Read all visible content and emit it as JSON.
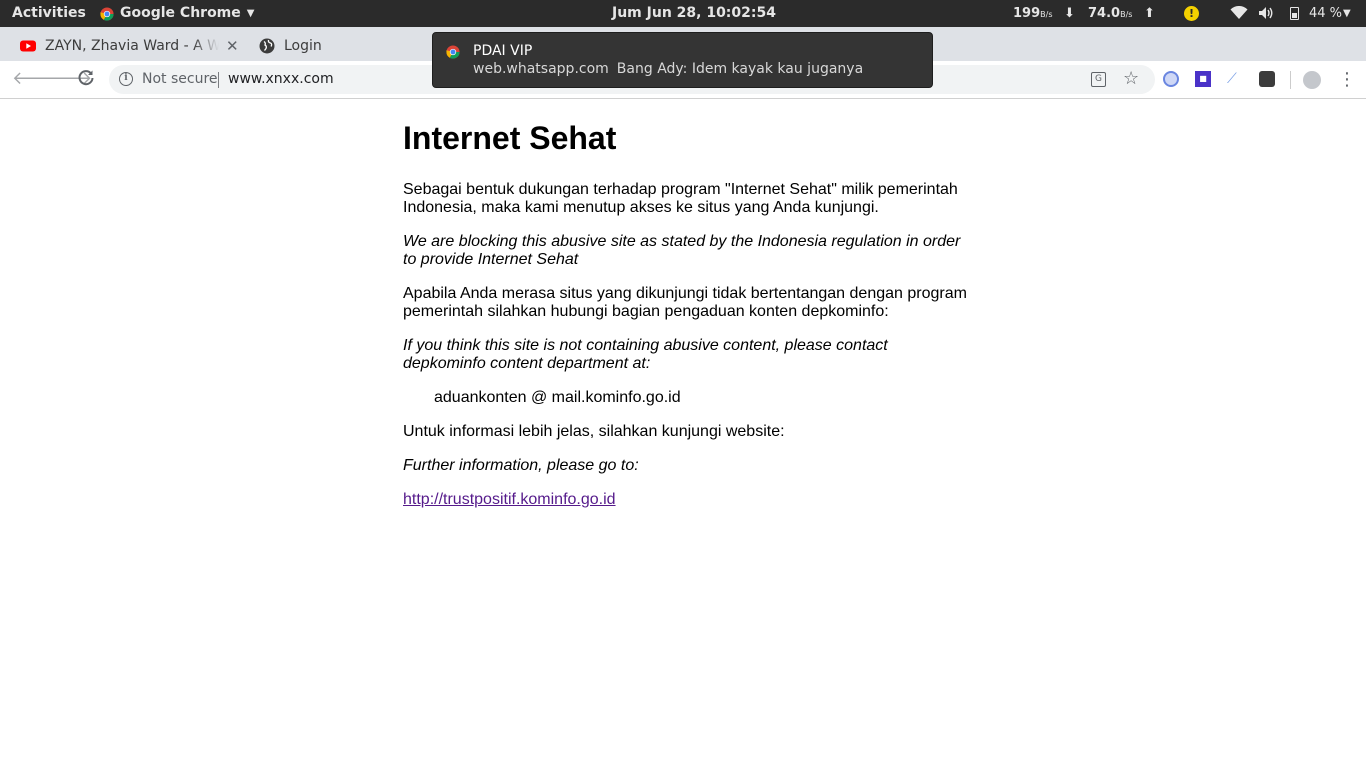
{
  "topbar": {
    "activities": "Activities",
    "app_name": "Google Chrome",
    "clock": "Jum Jun 28, 10:02:54",
    "net_down_value": "199",
    "net_down_unit": "B/s",
    "net_up_value": "74.0",
    "net_up_unit": "B/s",
    "battery_percent": "44 %"
  },
  "tabs": [
    {
      "title": "ZAYN, Zhavia Ward - A Whole New World",
      "favicon": "youtube-icon"
    },
    {
      "title": "Login",
      "favicon": "globe-icon"
    }
  ],
  "toolbar": {
    "security_label": "Not secure",
    "url": "www.xnxx.com"
  },
  "notification": {
    "title": "PDAI VIP",
    "source": "web.whatsapp.com",
    "message": "Bang Ady: Idem kayak kau juganya"
  },
  "page": {
    "heading": "Internet Sehat",
    "para_id_1": "Sebagai bentuk dukungan terhadap program \"Internet Sehat\" milik pemerintah Indonesia, maka kami menutup akses ke situs yang Anda kunjungi.",
    "para_en_1": "We are blocking this abusive site as stated by the Indonesia regulation in order to provide Internet Sehat",
    "para_id_2": "Apabila Anda merasa situs yang dikunjungi tidak bertentangan dengan program pemerintah silahkan hubungi bagian pengaduan konten depkominfo:",
    "para_en_2": "If you think this site is not containing abusive content, please contact depkominfo content department at:",
    "contact_email": "aduankonten @ mail.kominfo.go.id",
    "para_id_3": "Untuk informasi lebih jelas, silahkan kunjungi website:",
    "para_en_3": "Further information, please go to:",
    "link": "http://trustpositif.kominfo.go.id"
  },
  "colors": {
    "topbar_bg": "#2b2b2b",
    "tabstrip_bg": "#dee1e6",
    "link_visited": "#551a8b",
    "warning_yellow": "#f4d100"
  }
}
